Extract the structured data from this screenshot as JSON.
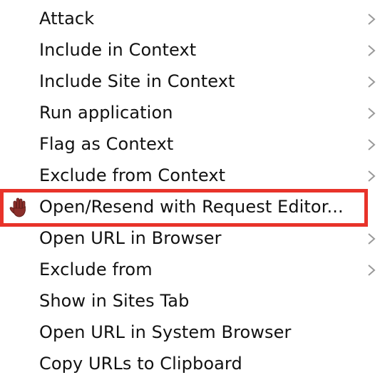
{
  "context_menu": {
    "items": [
      {
        "label": "Attack",
        "has_submenu": true
      },
      {
        "label": "Include in Context",
        "has_submenu": true
      },
      {
        "label": "Include Site in Context",
        "has_submenu": true
      },
      {
        "label": "Run application",
        "has_submenu": true
      },
      {
        "label": "Flag as Context",
        "has_submenu": true
      },
      {
        "label": "Exclude from Context",
        "has_submenu": true
      },
      {
        "label": "Open/Resend with Request Editor...",
        "has_submenu": false,
        "icon": "hand-icon",
        "highlighted": true
      },
      {
        "label": "Open URL in Browser",
        "has_submenu": true
      },
      {
        "label": "Exclude from",
        "has_submenu": true
      },
      {
        "label": "Show in Sites Tab",
        "has_submenu": false
      },
      {
        "label": "Open URL in System Browser",
        "has_submenu": false
      },
      {
        "label": "Copy URLs to Clipboard",
        "has_submenu": false
      }
    ]
  },
  "colors": {
    "text": "#111111",
    "chevron": "#9a9a9a",
    "highlight_border": "#e8332a",
    "background": "#ffffff"
  }
}
